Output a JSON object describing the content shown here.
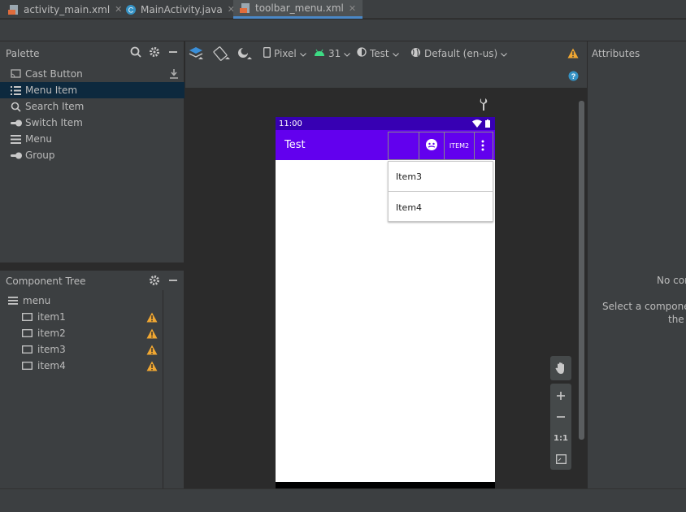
{
  "tabs": [
    {
      "label": "activity_main.xml",
      "icon": "xml-file-icon",
      "active": false
    },
    {
      "label": "MainActivity.java",
      "icon": "java-class-icon",
      "active": false
    },
    {
      "label": "toolbar_menu.xml",
      "icon": "xml-file-icon",
      "active": true
    }
  ],
  "palette": {
    "title": "Palette",
    "items": [
      {
        "label": "Cast Button",
        "icon": "cast-icon"
      },
      {
        "label": "Menu Item",
        "icon": "menu-list-icon"
      },
      {
        "label": "Search Item",
        "icon": "search-icon"
      },
      {
        "label": "Switch Item",
        "icon": "switch-icon"
      },
      {
        "label": "Menu",
        "icon": "hamburger-menu-icon"
      },
      {
        "label": "Group",
        "icon": "group-icon"
      }
    ]
  },
  "component_tree": {
    "title": "Component Tree",
    "root": "menu",
    "items": [
      "item1",
      "item2",
      "item3",
      "item4"
    ]
  },
  "design_toolbar": {
    "device": "Pixel",
    "api": "31",
    "theme": "Test",
    "locale": "Default (en-us)"
  },
  "preview": {
    "status_time": "11:00",
    "app_title": "Test",
    "action_text": "ITEM2",
    "overflow_items": [
      "Item3",
      "Item4"
    ],
    "colors": {
      "status": "#3700b3",
      "appbar": "#6200ee"
    }
  },
  "zoom": {
    "reset_label": "1:1"
  },
  "attributes": {
    "title": "Attributes",
    "line1": "No cor",
    "line2": "Select a component",
    "line3": "the l"
  }
}
